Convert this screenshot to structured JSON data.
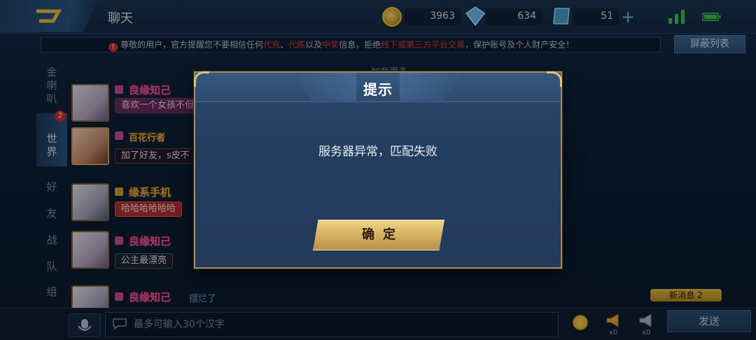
{
  "header": {
    "title": "聊天",
    "coins": "3963",
    "diamonds": "634",
    "vouchers": "51"
  },
  "notice": {
    "p1": "尊敬的用户，官方提醒您不要相信任何",
    "r1": "代充",
    "p2": "、",
    "r2": "代练",
    "p3": "以及",
    "r3": "中奖",
    "p4": "信息，拒绝",
    "r4": "线下或第三方平台交易",
    "p5": "，保护账号及个人财产安全！"
  },
  "block_list_label": "屏蔽列表",
  "tabs": [
    {
      "label": "金\n喇\n叭"
    },
    {
      "label": "世\n界",
      "badge": "2"
    },
    {
      "label": "好\n友"
    },
    {
      "label": "战\n队"
    },
    {
      "label": "组\n队"
    }
  ],
  "chat": {
    "load_more": "加载更多",
    "messages": [
      {
        "nick": "良缘知己",
        "text": "喜欢一个女孩不但"
      },
      {
        "nick": "百花行者",
        "text": "加了好友，s皮不"
      },
      {
        "nick": "缘系手机",
        "text": "哈哈哈哈哈哈"
      },
      {
        "nick": "良缘知己",
        "text": "公主最漂亮"
      },
      {
        "nick": "良缘知己",
        "text": "摆烂了"
      }
    ],
    "new_message": "新消息 2"
  },
  "input": {
    "placeholder": "最多可输入30个汉字"
  },
  "horn_counts": [
    "x0",
    "x0"
  ],
  "send_label": "发送",
  "dialog": {
    "title": "提示",
    "message": "服务器异常，匹配失败",
    "confirm": "确定"
  }
}
